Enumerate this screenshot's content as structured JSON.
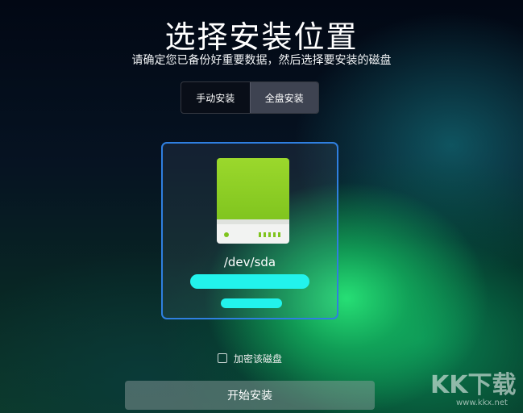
{
  "header": {
    "title": "选择安装位置",
    "subtitle": "请确定您已备份好重要数据，然后选择要安装的磁盘"
  },
  "tabs": [
    {
      "label": "手动安装",
      "active": false
    },
    {
      "label": "全盘安装",
      "active": true
    }
  ],
  "disk": {
    "name": "/dev/sda",
    "icon": "hard-disk-icon",
    "size": "",
    "model": "",
    "redacted_color": "#22f3ec"
  },
  "encrypt": {
    "label": "加密该磁盘",
    "checked": false
  },
  "start_button": {
    "label": "开始安装"
  },
  "watermark": {
    "text": "KK下载",
    "url": "www.kkx.net"
  },
  "colors": {
    "selection_border": "#2f7fe0",
    "disk_green": "#8fd12a"
  }
}
